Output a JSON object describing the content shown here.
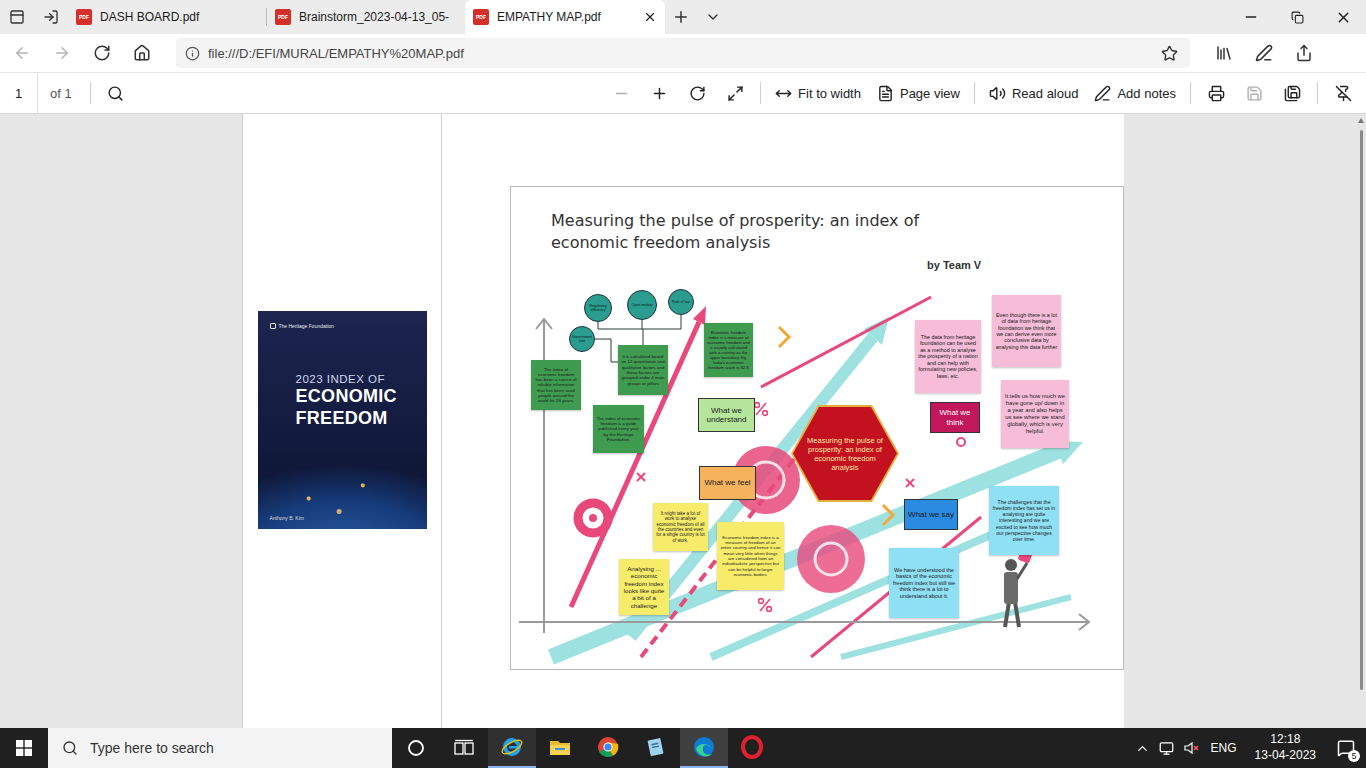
{
  "browser": {
    "tabs": [
      {
        "label": "DASH BOARD.pdf",
        "selected": false
      },
      {
        "label": "Brainstorm_2023-04-13_05-",
        "selected": false
      },
      {
        "label": "EMPATHY MAP.pdf",
        "selected": true
      }
    ],
    "tab_icon_text": "PDF",
    "nav": [
      {
        "kind": "back",
        "disabled": true
      },
      {
        "kind": "forward",
        "disabled": true
      },
      {
        "kind": "refresh",
        "disabled": false
      },
      {
        "kind": "home",
        "disabled": false
      }
    ],
    "url": "file:///D:/EFI/MURAL/EMPATHY%20MAP.pdf"
  },
  "pdf_toolbar": {
    "page": "1",
    "page_count": "of 1",
    "tools": [
      {
        "kind": "search",
        "disabled": false
      },
      {
        "kind": "zoom-out",
        "disabled": true
      },
      {
        "kind": "zoom-in",
        "disabled": false
      },
      {
        "kind": "rotate",
        "disabled": false
      },
      {
        "kind": "fullscreen",
        "disabled": false
      },
      {
        "kind": "fit",
        "label": "Fit to width",
        "disabled": false
      },
      {
        "kind": "page-view",
        "label": "Page view",
        "disabled": false
      },
      {
        "kind": "read-aloud",
        "label": "Read aloud",
        "disabled": false
      },
      {
        "kind": "add-notes",
        "label": "Add notes",
        "disabled": false
      },
      {
        "kind": "print",
        "disabled": false
      },
      {
        "kind": "save",
        "disabled": true
      },
      {
        "kind": "save-as",
        "disabled": false
      },
      {
        "kind": "pin",
        "disabled": false
      }
    ]
  },
  "cover": {
    "publisher": "The Heritage Foundation",
    "title_lines": [
      "2023 INDEX OF",
      "ECONOMIC",
      "FREEDOM"
    ],
    "author": "Anthony B. Kim"
  },
  "mural": {
    "title_lines": [
      "Measuring the pulse of prosperity: an index of",
      "economic freedom analysis"
    ],
    "byline": "by Team V",
    "center": "Measuring the pulse of prosperity: an index of economic freedom analysis",
    "pillars": [
      "Regulatory efficiency",
      "Open market",
      "Rule of law",
      "Government size"
    ],
    "labels": [
      {
        "text": "What we understand",
        "color": "#b5e69c"
      },
      {
        "text": "What we feel",
        "color": "#f7b25e"
      },
      {
        "text": "What we think",
        "color": "#c2185b"
      },
      {
        "text": "What we say",
        "color": "#2b8be0"
      }
    ],
    "notes": [
      {
        "text": "The index of economic freedom has been a source of reliable information that has been used people around the world for 28 years.",
        "color": "#3f9b4f"
      },
      {
        "text": "It is calculated based on 12 quantitative and qualitative factors and these factors are grouped under 4 main groups or pillars",
        "color": "#3f9b4f"
      },
      {
        "text": "The index of economic freedom is a guide published every year by the Heritage Foundation.",
        "color": "#3f9b4f"
      },
      {
        "text": "Economic freedom index is a measure of economic freedom and is usually calculated with a country as the upper boundary. Eg. India's economic freedom score is 52.9",
        "color": "#3f9b4f"
      },
      {
        "text": "It might take a lot of work to analyse economic freedom of all the countries and even for a single country is lot of work.",
        "color": "#f7ec6a"
      },
      {
        "text": "Analysing ... economic freedom index looks like quite a bit of a challenge",
        "color": "#f7ec6a"
      },
      {
        "text": "Economic freedom index is a measure of freedom of an entire country and hence it can mean very little when things are considered from an individualistic perspective but can be helpful to larger economic bodies.",
        "color": "#f7ec6a"
      },
      {
        "text": "The data from heritage foundation can be used as a method to analyse the prosperity of a nation and can help with formulating new policies, laws, etc.",
        "color": "#f6bcd8"
      },
      {
        "text": "Even though there is a lot of data from heritage foundation we think that we can derive even more conclusive data by analysing this data further",
        "color": "#f6bcd8"
      },
      {
        "text": "It tells us how much we have gone up/ down in a year and also helps us see where we stand globally, which is very helpful.",
        "color": "#f6bcd8"
      },
      {
        "text": "The challenges that the freedom index has set us in analysing are quite interesting and we are excited to see how much our perspective changes over time.",
        "color": "#8fdff5"
      },
      {
        "text": "We have understood the basics of the economic freedom index but still we think there is a lot to understand about it.",
        "color": "#8fdff5"
      }
    ]
  },
  "taskbar": {
    "search_placeholder": "Type here to search",
    "apps": [
      {
        "kind": "ie",
        "selected": false,
        "running": true
      },
      {
        "kind": "explorer",
        "selected": false,
        "running": false
      },
      {
        "kind": "chrome",
        "selected": false,
        "running": false
      },
      {
        "kind": "notepad",
        "selected": false,
        "running": false
      },
      {
        "kind": "edge",
        "selected": true,
        "running": true
      },
      {
        "kind": "opera",
        "selected": false,
        "running": false
      }
    ],
    "tray": {
      "lang": "ENG",
      "time": "12:18",
      "date": "13-04-2023",
      "notifications": "5",
      "volume_muted": true
    }
  }
}
